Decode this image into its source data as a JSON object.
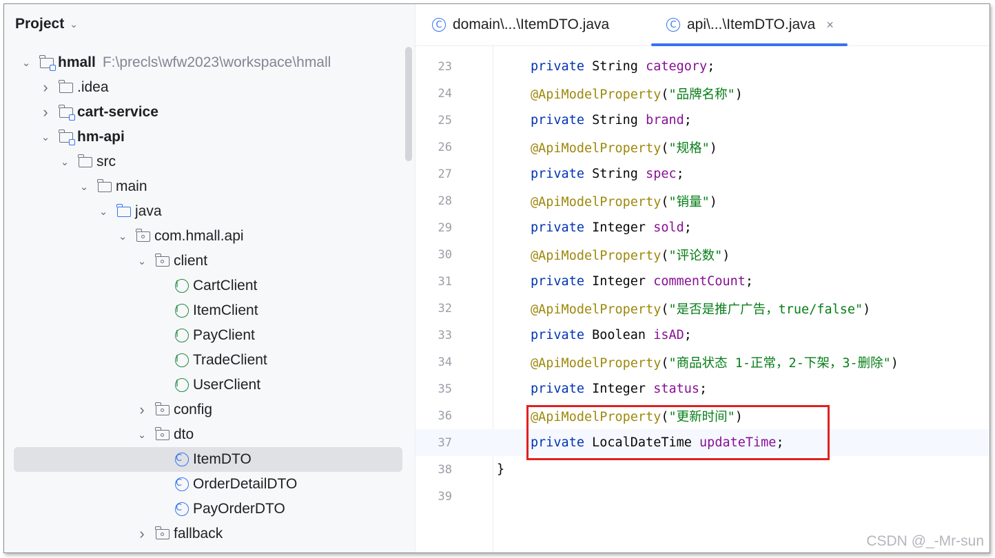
{
  "project": {
    "title": "Project",
    "tree": [
      {
        "label": "hmall",
        "path": "F:\\precls\\wfw2023\\workspace\\hmall",
        "icon": "module-folder-icon",
        "arrow": "expanded",
        "bold": true
      },
      {
        "label": ".idea",
        "icon": "folder-icon",
        "arrow": "collapsed"
      },
      {
        "label": "cart-service",
        "icon": "module-folder-icon",
        "arrow": "collapsed",
        "bold": true
      },
      {
        "label": "hm-api",
        "icon": "module-folder-icon",
        "arrow": "expanded",
        "bold": true
      },
      {
        "label": "src",
        "icon": "folder-icon",
        "arrow": "expanded"
      },
      {
        "label": "main",
        "icon": "folder-icon",
        "arrow": "expanded"
      },
      {
        "label": "java",
        "icon": "source-folder-icon",
        "arrow": "expanded"
      },
      {
        "label": "com.hmall.api",
        "icon": "package-icon",
        "arrow": "expanded"
      },
      {
        "label": "client",
        "icon": "package-icon",
        "arrow": "expanded"
      },
      {
        "label": "CartClient",
        "icon": "interface-icon",
        "glyph": "I"
      },
      {
        "label": "ItemClient",
        "icon": "interface-icon",
        "glyph": "I"
      },
      {
        "label": "PayClient",
        "icon": "interface-icon",
        "glyph": "I"
      },
      {
        "label": "TradeClient",
        "icon": "interface-icon",
        "glyph": "I"
      },
      {
        "label": "UserClient",
        "icon": "interface-icon",
        "glyph": "I"
      },
      {
        "label": "config",
        "icon": "package-icon",
        "arrow": "collapsed"
      },
      {
        "label": "dto",
        "icon": "package-icon",
        "arrow": "expanded"
      },
      {
        "label": "ItemDTO",
        "icon": "class-icon",
        "glyph": "C",
        "selected": true
      },
      {
        "label": "OrderDetailDTO",
        "icon": "class-icon",
        "glyph": "C"
      },
      {
        "label": "PayOrderDTO",
        "icon": "class-icon",
        "glyph": "C"
      },
      {
        "label": "fallback",
        "icon": "package-icon",
        "arrow": "collapsed"
      }
    ]
  },
  "editor": {
    "tabs": [
      {
        "label": "domain\\...\\ItemDTO.java",
        "glyph": "C",
        "active": false
      },
      {
        "label": "api\\...\\ItemDTO.java",
        "glyph": "C",
        "active": true,
        "close": "×"
      }
    ],
    "lines": [
      {
        "num": "23",
        "code": "private String category;"
      },
      {
        "num": "24",
        "code": "@ApiModelProperty(\"品牌名称\")"
      },
      {
        "num": "25",
        "code": "private String brand;"
      },
      {
        "num": "26",
        "code": "@ApiModelProperty(\"规格\")"
      },
      {
        "num": "27",
        "code": "private String spec;"
      },
      {
        "num": "28",
        "code": "@ApiModelProperty(\"销量\")"
      },
      {
        "num": "29",
        "code": "private Integer sold;"
      },
      {
        "num": "30",
        "code": "@ApiModelProperty(\"评论数\")"
      },
      {
        "num": "31",
        "code": "private Integer commentCount;"
      },
      {
        "num": "32",
        "code": "@ApiModelProperty(\"是否是推广广告，true/false\")"
      },
      {
        "num": "33",
        "code": "private Boolean isAD;"
      },
      {
        "num": "34",
        "code": "@ApiModelProperty(\"商品状态 1-正常，2-下架，3-删除\")"
      },
      {
        "num": "35",
        "code": "private Integer status;"
      },
      {
        "num": "36",
        "code": "@ApiModelProperty(\"更新时间\")"
      },
      {
        "num": "37",
        "code": "private LocalDateTime updateTime;",
        "current": true
      },
      {
        "num": "38",
        "code": "}"
      },
      {
        "num": "39",
        "code": ""
      }
    ]
  },
  "watermark": "CSDN @_-Mr-sun",
  "colors": {
    "keyword": "#0033b3",
    "annotation": "#9e880d",
    "string": "#067d17",
    "field": "#871094",
    "highlight": "#e02020"
  }
}
